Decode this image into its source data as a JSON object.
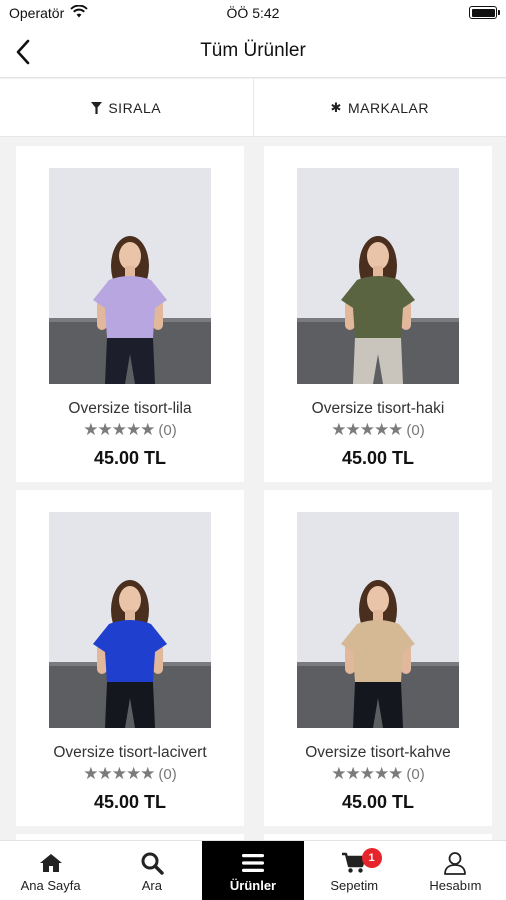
{
  "status_bar": {
    "carrier": "Operatör",
    "time": "ÖÖ 5:42"
  },
  "header": {
    "title": "Tüm Ürünler"
  },
  "filters": {
    "sort_label": "SIRALA",
    "brands_label": "MARKALAR"
  },
  "products": [
    {
      "name": "Oversize tisort-lila",
      "rating_count": "(0)",
      "price": "45.00 TL",
      "shirt_color": "#b7a6df",
      "pants_color": "#1c1f2b"
    },
    {
      "name": "Oversize tisort-haki",
      "rating_count": "(0)",
      "price": "45.00 TL",
      "shirt_color": "#5a6440",
      "pants_color": "#c9c5bd"
    },
    {
      "name": "Oversize tisort-lacivert",
      "rating_count": "(0)",
      "price": "45.00 TL",
      "shirt_color": "#1f3fcf",
      "pants_color": "#15171f"
    },
    {
      "name": "Oversize tisort-kahve",
      "rating_count": "(0)",
      "price": "45.00 TL",
      "shirt_color": "#d5b995",
      "pants_color": "#15171f"
    }
  ],
  "stars": "★★★★★",
  "tabs": [
    {
      "label": "Ana Sayfa",
      "icon": "home-icon"
    },
    {
      "label": "Ara",
      "icon": "search-icon"
    },
    {
      "label": "Ürünler",
      "icon": "menu-icon",
      "active": true
    },
    {
      "label": "Sepetim",
      "icon": "cart-icon",
      "badge": "1"
    },
    {
      "label": "Hesabım",
      "icon": "user-icon"
    }
  ]
}
